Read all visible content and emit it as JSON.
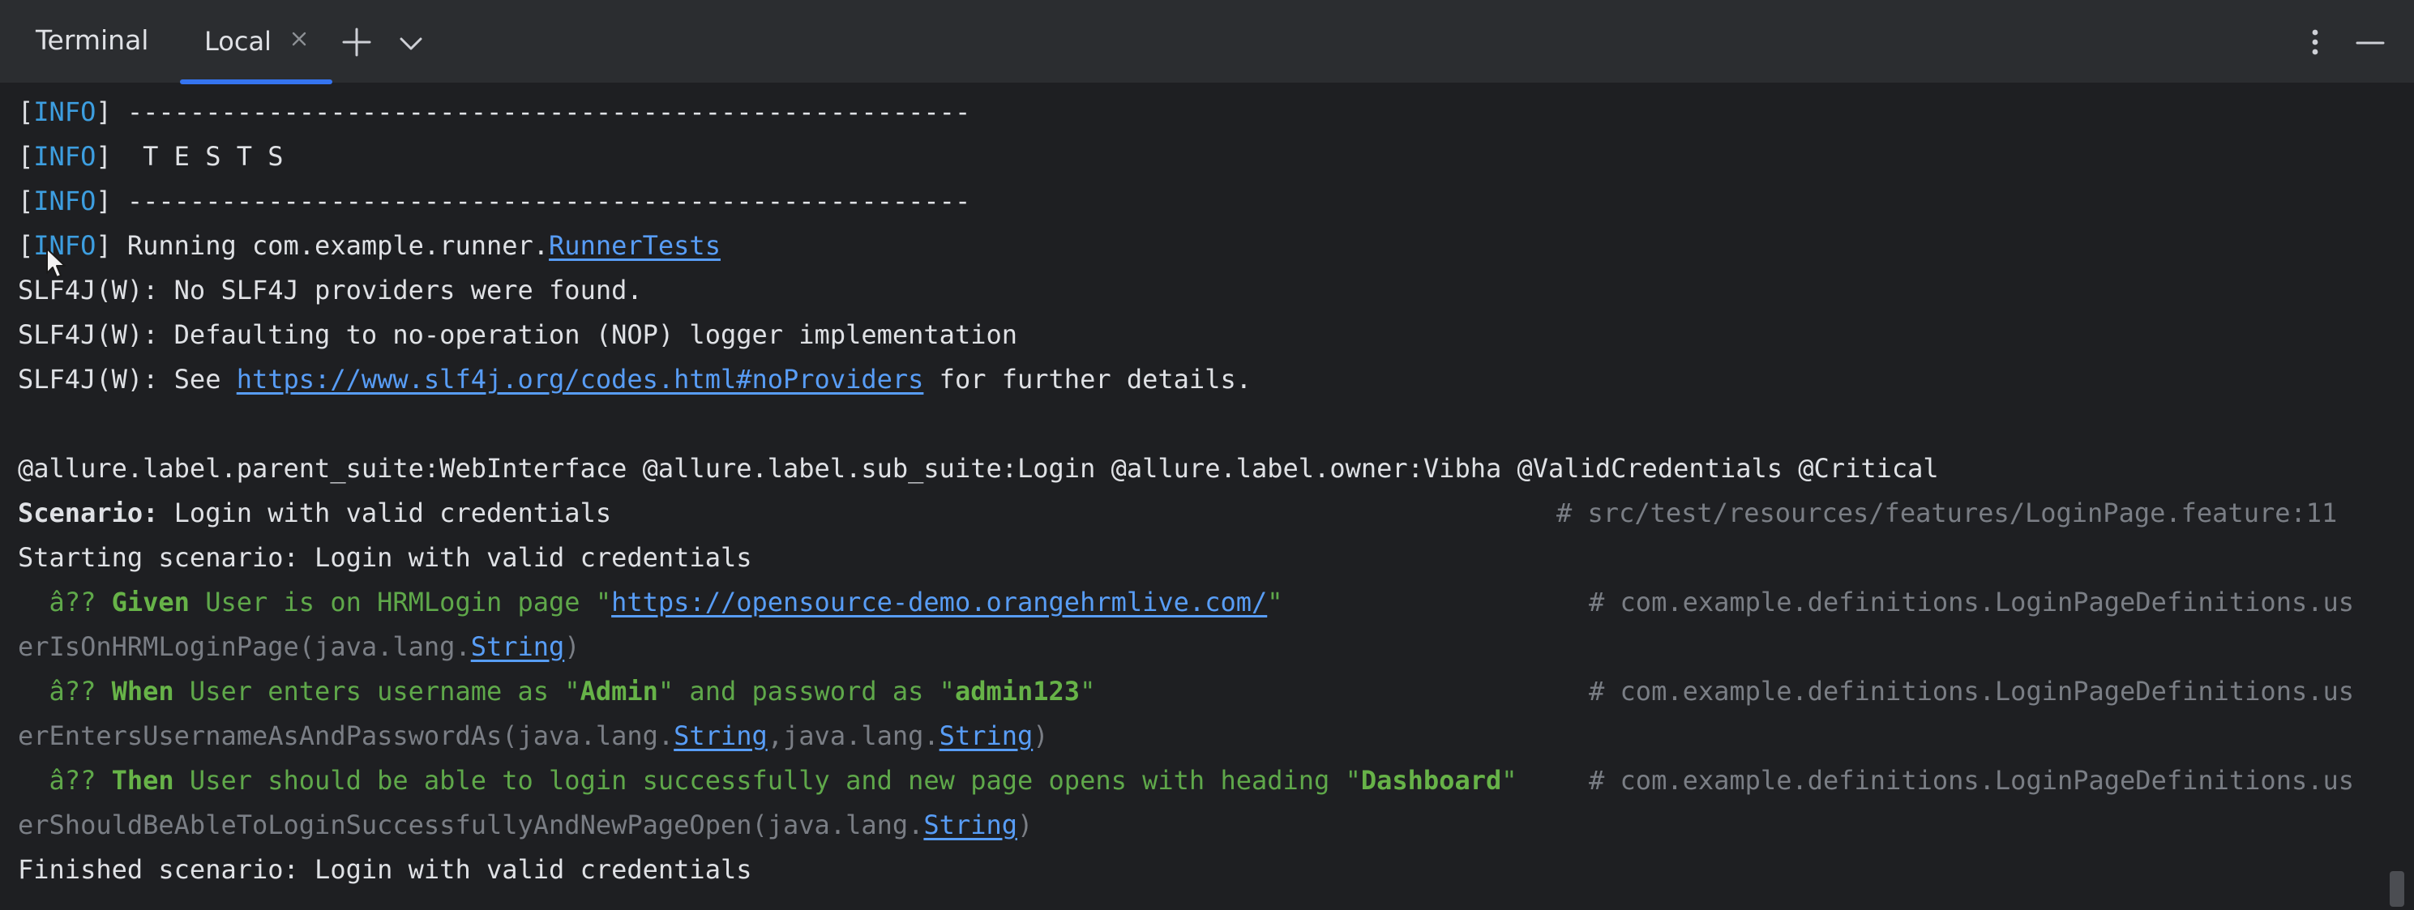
{
  "toolwindow": {
    "title": "Terminal",
    "tab_label": "Local",
    "accent_color": "#3574f0",
    "icons": {
      "close": "close-icon",
      "add": "plus-icon",
      "dropdown": "chevron-down-icon",
      "more": "more-vertical-icon",
      "minimize": "minimize-icon"
    }
  },
  "terminal": {
    "l1": {
      "tag": "INFO",
      "text": "------------------------------------------------------"
    },
    "l2": {
      "tag": "INFO",
      "text": " T E S T S"
    },
    "l3": {
      "tag": "INFO",
      "text": "------------------------------------------------------"
    },
    "l4": {
      "tag": "INFO",
      "prefix": "Running com.example.runner.",
      "link": "RunnerTests"
    },
    "l5": "SLF4J(W): No SLF4J providers were found.",
    "l6": "SLF4J(W): Defaulting to no-operation (NOP) logger implementation",
    "l7": {
      "prefix": "SLF4J(W): See ",
      "link": "https://www.slf4j.org/codes.html#noProviders",
      "suffix": " for further details."
    },
    "l8": "@allure.label.parent_suite:WebInterface @allure.label.sub_suite:Login @allure.label.owner:Vibha @ValidCredentials @Critical",
    "l9": {
      "keyword": "Scenario:",
      "text": " Login with valid credentials",
      "comment": "# src/test/resources/features/LoginPage.feature:11"
    },
    "l10": "Starting scenario: Login with valid credentials",
    "l11": {
      "marker": "â??",
      "keyword": "Given",
      "text1": " User is on HRMLogin page \"",
      "link": "https://opensource-demo.orangehrmlive.com/",
      "text2": "\"",
      "comment": "# com.example.definitions.LoginPageDefinitions.us"
    },
    "l12": {
      "text": "erIsOnHRMLoginPage(java.lang.",
      "link": "String",
      "suffix": ")"
    },
    "l13": {
      "marker": "â??",
      "keyword": "When",
      "text1": " User enters username as \"",
      "arg1": "Admin",
      "text2": "\" and password as \"",
      "arg2": "admin123",
      "text3": "\"",
      "comment": "# com.example.definitions.LoginPageDefinitions.us"
    },
    "l14": {
      "text": "erEntersUsernameAsAndPasswordAs(java.lang.",
      "link1": "String",
      "mid": ",java.lang.",
      "link2": "String",
      "suffix": ")"
    },
    "l15": {
      "marker": "â??",
      "keyword": "Then",
      "text1": " User should be able to login successfully and new page opens with heading \"",
      "arg1": "Dashboard",
      "text2": "\"",
      "comment": "# com.example.definitions.LoginPageDefinitions.us"
    },
    "l16": {
      "text": "erShouldBeAbleToLoginSuccessfullyAndNewPageOpen(java.lang.",
      "link": "String",
      "suffix": ")"
    },
    "l17": "Finished scenario: Login with valid credentials"
  }
}
